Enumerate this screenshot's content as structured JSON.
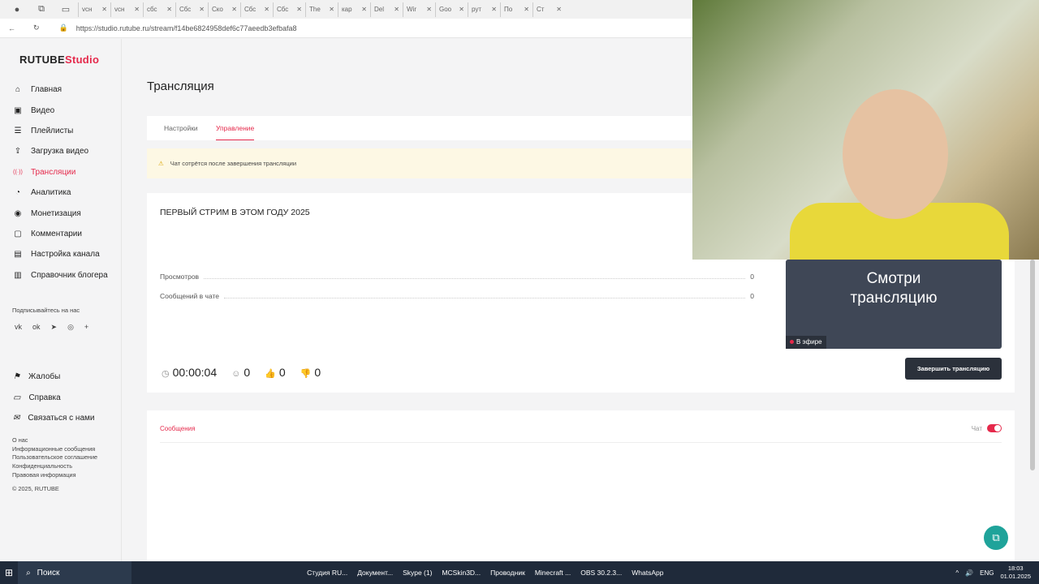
{
  "browser": {
    "tabs": [
      "vcн",
      "vcн",
      "cбс",
      "Сбс",
      "Ско",
      "Сбс",
      "Сбс",
      "The",
      "кар",
      "Del",
      "Wir",
      "Goo",
      "рут",
      "По",
      "Ст"
    ],
    "url": "https://studio.rutube.ru/stream/f14be6824958def6c77aeedb3efbafa8"
  },
  "logo": {
    "brand": "RUTUBE",
    "product": "Studio"
  },
  "sidebar": {
    "items": [
      {
        "label": "Главная",
        "icon": "home-icon"
      },
      {
        "label": "Видео",
        "icon": "video-icon"
      },
      {
        "label": "Плейлисты",
        "icon": "list-icon"
      },
      {
        "label": "Загрузка видео",
        "icon": "upload-icon"
      },
      {
        "label": "Трансляции",
        "icon": "broadcast-icon",
        "active": true
      },
      {
        "label": "Аналитика",
        "icon": "chart-icon"
      },
      {
        "label": "Монетизация",
        "icon": "coin-icon"
      },
      {
        "label": "Комментарии",
        "icon": "comment-icon"
      },
      {
        "label": "Настройка канала",
        "icon": "settings-icon"
      },
      {
        "label": "Справочник блогера",
        "icon": "book-icon"
      }
    ],
    "subscribe_label": "Подписывайтесь на нас",
    "social": [
      "vk",
      "ok",
      "telegram",
      "viber",
      "more"
    ],
    "items2": [
      {
        "label": "Жалобы",
        "icon": "flag-icon"
      },
      {
        "label": "Справка",
        "icon": "help-icon"
      },
      {
        "label": "Связаться с нами",
        "icon": "mail-icon"
      }
    ],
    "footer": [
      "О нас",
      "Информационные сообщения",
      "Пользовательское соглашение",
      "Конфиденциальность",
      "Правовая информация"
    ],
    "copyright": "© 2025, RUTUBE"
  },
  "page": {
    "title": "Трансляция",
    "tabs": [
      "Настройки",
      "Управление"
    ],
    "active_tab": "Управление",
    "warning": "Чат сотрётся после завершения трансляции",
    "stream_title": "ПЕРВЫЙ СТРИМ В ЭТОМ ГОДУ 2025",
    "stats_rows": [
      {
        "label": "Просмотров",
        "value": "0"
      },
      {
        "label": "Сообщений в чате",
        "value": "0"
      }
    ],
    "timer": "00:00:04",
    "viewers": "0",
    "likes": "0",
    "dislikes": "0",
    "preview_text": "Смотри трансляцию",
    "live_badge": "В эфире",
    "end_button": "Завершить трансляцию",
    "messages_tab": "Сообщения",
    "chat_toggle_label": "Чат",
    "chat_enabled": true
  },
  "taskbar": {
    "search": "Поиск",
    "apps": [
      "Студия RU...",
      "Документ...",
      "Skype (1)",
      "MCSkin3D...",
      "Проводник",
      "Minecraft ...",
      "OBS 30.2.3...",
      "WhatsApp"
    ],
    "lang": "ENG",
    "time": "18:03",
    "date": "01.01.2025"
  },
  "colors": {
    "accent": "#e5294b",
    "warning_bg": "#fdf8e4",
    "button_dark": "#2b313b"
  }
}
